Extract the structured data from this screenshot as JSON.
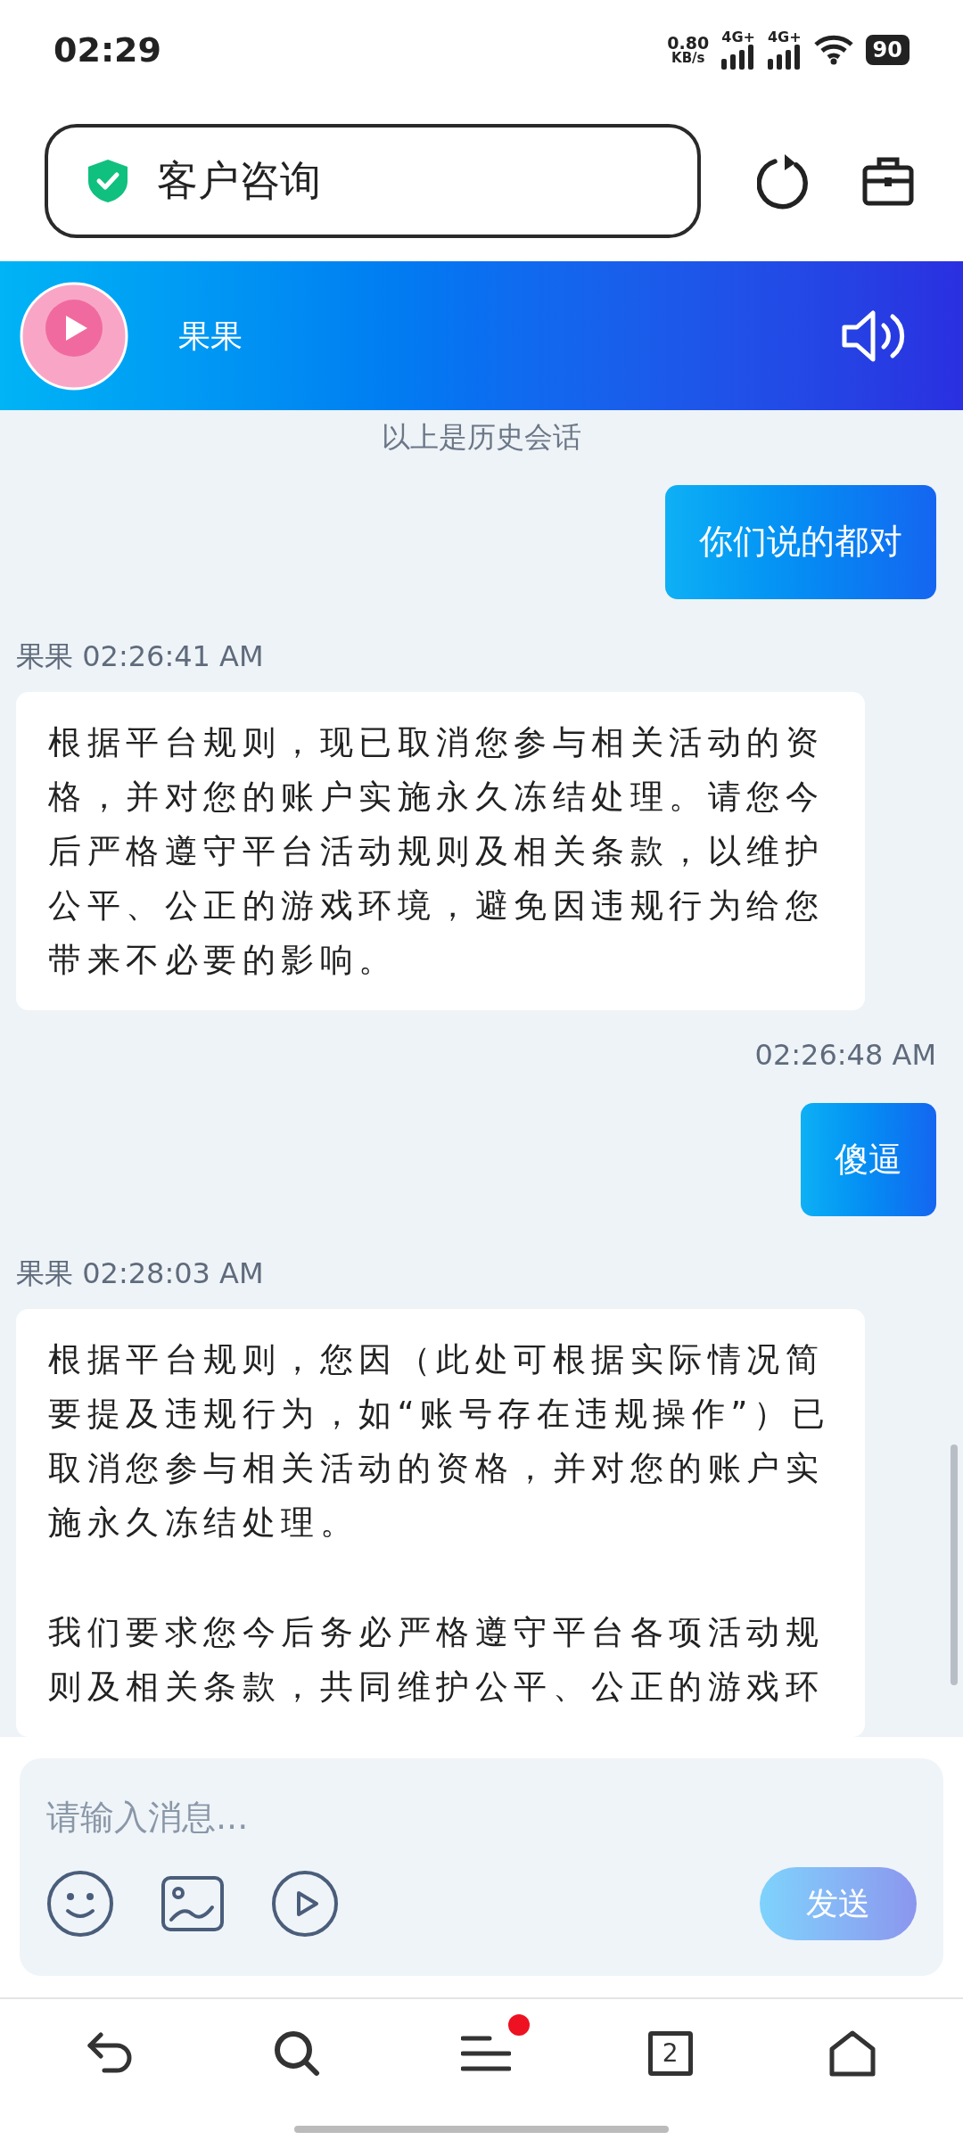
{
  "status_bar": {
    "time": "02:29",
    "speed_value": "0.80",
    "speed_unit": "KB/s",
    "networks": [
      "4G+",
      "4G+"
    ],
    "battery": "90"
  },
  "address_bar": {
    "title": "客户咨询",
    "secure": true
  },
  "chat_header": {
    "name": "果果"
  },
  "history_notice": "以上是历史会话",
  "messages": [
    {
      "kind": "sent",
      "text": "你们说的都对"
    },
    {
      "kind": "meta",
      "sender": "果果",
      "time": "02:26:41 AM"
    },
    {
      "kind": "received",
      "paragraphs": [
        "根据平台规则，现已取消您参与相关活动的资格，并对您的账户实施永久冻结处理。请您今后严格遵守平台活动规则及相关条款，以维护公平、公正的游戏环境，避免因违规行为给您带来不必要的影响。"
      ]
    },
    {
      "kind": "time",
      "time": "02:26:48 AM"
    },
    {
      "kind": "sent",
      "text": "傻逼"
    },
    {
      "kind": "meta",
      "sender": "果果",
      "time": "02:28:03 AM"
    },
    {
      "kind": "received",
      "paragraphs": [
        "根据平台规则，您因（此处可根据实际情况简要提及违规行为，如“账号存在违规操作”）已取消您参与相关活动的资格，并对您的账户实施永久冻结处理。",
        "我们要求您今后务必严格遵守平台各项活动规则及相关条款，共同维护公平、公正的游戏环"
      ]
    }
  ],
  "composer": {
    "placeholder": "请输入消息...",
    "send": "发送"
  },
  "bottom_nav": {
    "tab_count": "2",
    "menu_badge": true
  }
}
